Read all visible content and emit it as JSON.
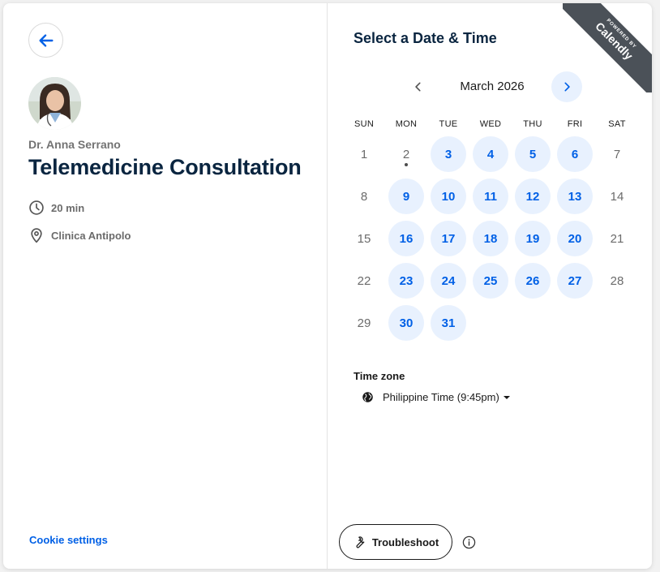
{
  "event": {
    "host_name": "Dr. Anna Serrano",
    "title": "Telemedicine Consultation",
    "duration": "20 min",
    "location": "Clinica Antipolo"
  },
  "footer": {
    "cookie_settings": "Cookie settings"
  },
  "scheduler": {
    "title": "Select a Date & Time",
    "month_label": "March 2026",
    "weekdays": [
      "SUN",
      "MON",
      "TUE",
      "WED",
      "THU",
      "FRI",
      "SAT"
    ],
    "first_weekday_index": 0,
    "days_in_month": 31,
    "today": 2,
    "available_days": [
      3,
      4,
      5,
      6,
      9,
      10,
      11,
      12,
      13,
      16,
      17,
      18,
      19,
      20,
      23,
      24,
      25,
      26,
      27,
      30,
      31
    ]
  },
  "timezone": {
    "label": "Time zone",
    "value": "Philippine Time (9:45pm)"
  },
  "troubleshoot": {
    "label": "Troubleshoot"
  },
  "badge": {
    "powered_by": "POWERED BY",
    "brand": "Calendly"
  },
  "icons": {
    "back": "arrow-left-icon",
    "duration": "clock-icon",
    "location": "map-pin-icon",
    "prev": "chevron-left-icon",
    "next": "chevron-right-icon",
    "timezone": "globe-icon",
    "troubleshoot": "wrench-icon",
    "info": "info-icon"
  },
  "colors": {
    "accent": "#0060e6",
    "available_bg": "#e8f1fe",
    "title": "#0a2540",
    "ribbon": "#4b5158"
  }
}
